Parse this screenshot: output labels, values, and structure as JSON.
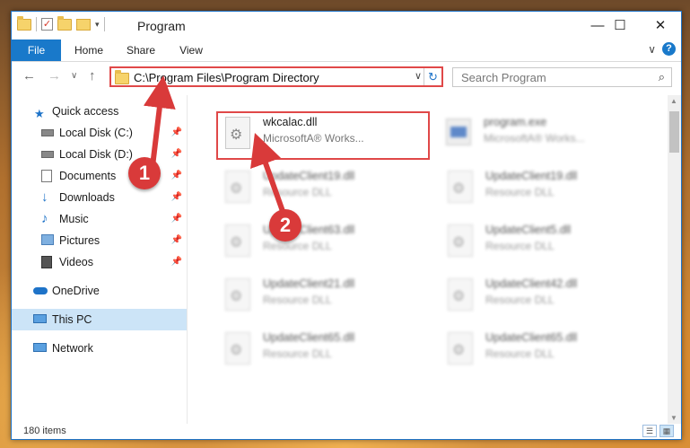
{
  "window": {
    "title": "Program"
  },
  "title_bar": {
    "minimize": "—",
    "maximize": "☐",
    "close": "✕",
    "qat_dropdown": "▾"
  },
  "ribbon": {
    "tabs": [
      "File",
      "Home",
      "Share",
      "View"
    ],
    "collapse": "∨",
    "help": "?"
  },
  "navigation": {
    "back": "←",
    "forward": "→",
    "recent": "∨",
    "up": "↑",
    "address": "C:\\Program Files\\Program Directory",
    "address_dropdown": "∨",
    "refresh": "↻",
    "search_placeholder": "Search Program",
    "search_icon": "⌕"
  },
  "sidebar": {
    "items": [
      {
        "label": "Quick access",
        "icon": "star-icon"
      },
      {
        "label": "Local Disk (C:)",
        "icon": "drive-icon",
        "pinned": true
      },
      {
        "label": "Local Disk (D:)",
        "icon": "drive-icon",
        "pinned": true
      },
      {
        "label": "Documents",
        "icon": "documents-icon",
        "pinned": true
      },
      {
        "label": "Downloads",
        "icon": "downloads-icon",
        "pinned": true
      },
      {
        "label": "Music",
        "icon": "music-icon",
        "pinned": true
      },
      {
        "label": "Pictures",
        "icon": "pictures-icon",
        "pinned": true
      },
      {
        "label": "Videos",
        "icon": "videos-icon",
        "pinned": true
      },
      {
        "label": "OneDrive",
        "icon": "cloud-icon"
      },
      {
        "label": "This PC",
        "icon": "computer-icon",
        "selected": true
      },
      {
        "label": "Network",
        "icon": "network-icon"
      }
    ],
    "pin_glyph": "📌"
  },
  "files": [
    {
      "name": "wkcalac.dll",
      "desc": "MicrosoftA® Works..."
    },
    {
      "name": "program.exe",
      "desc": "MicrosoftA® Works..."
    },
    {
      "name": "UpdateClient19.dll",
      "desc": "Resource DLL"
    },
    {
      "name": "UpdateClient19.dll",
      "desc": "Resource DLL"
    },
    {
      "name": "UpdateClient63.dll",
      "desc": "Resource DLL"
    },
    {
      "name": "UpdateClient5.dll",
      "desc": "Resource DLL"
    },
    {
      "name": "UpdateClient21.dll",
      "desc": "Resource DLL"
    },
    {
      "name": "UpdateClient42.dll",
      "desc": "Resource DLL"
    },
    {
      "name": "UpdateClient65.dll",
      "desc": "Resource DLL"
    },
    {
      "name": "UpdateClient65.dll",
      "desc": "Resource DLL"
    }
  ],
  "status": {
    "item_count": "180 items"
  },
  "callouts": [
    "1",
    "2"
  ],
  "colors": {
    "accent": "#1979ca",
    "highlight": "#e04848",
    "selected_bg": "#cce4f7"
  }
}
